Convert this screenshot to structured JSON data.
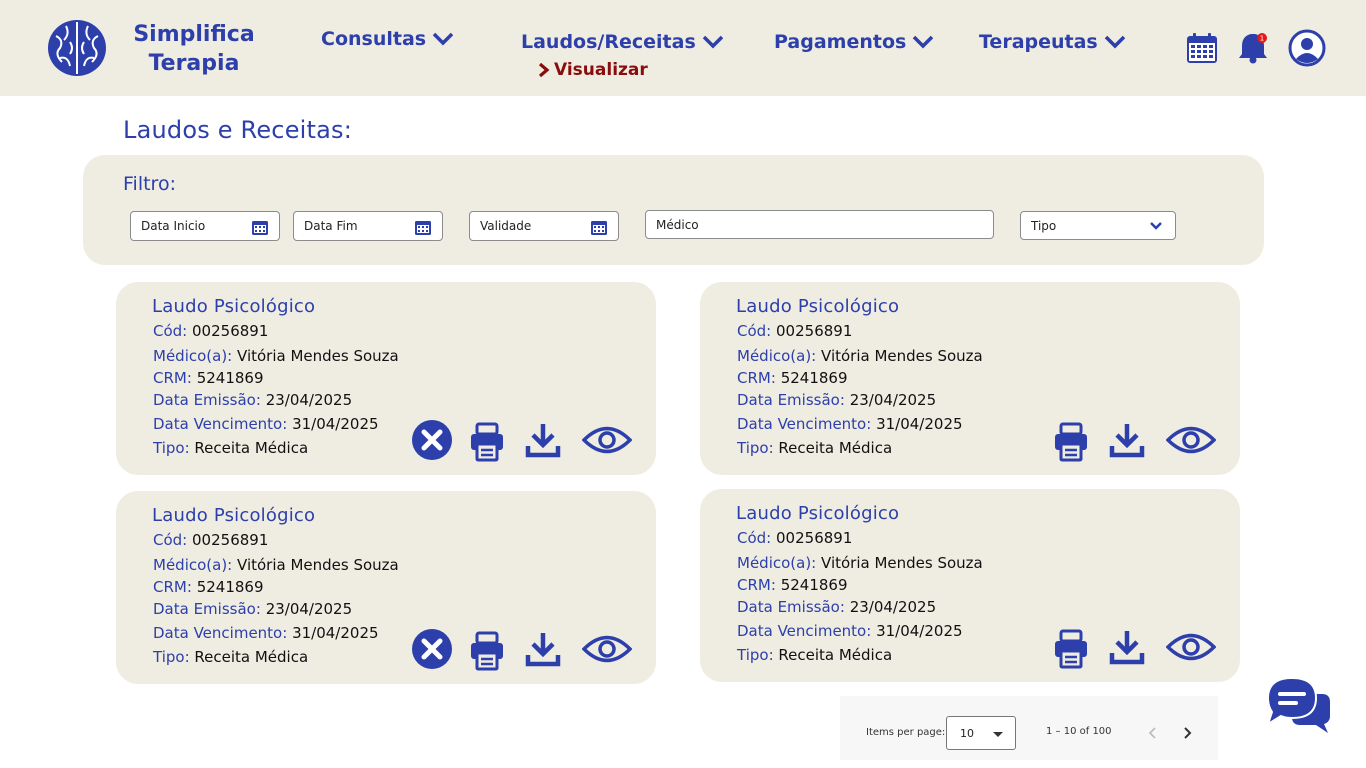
{
  "brand": {
    "line1": "Simplifica",
    "line2": "Terapia",
    "logo_icon": "brain-icon"
  },
  "nav": {
    "consultas": "Consultas",
    "laudos": "Laudos/Receitas",
    "laudos_sub": "Visualizar",
    "pagamentos": "Pagamentos",
    "terapeutas": "Terapeutas"
  },
  "header_icons": {
    "calendar": "calendar-icon",
    "bell": "bell-icon",
    "bell_badge": "1",
    "user": "user-icon"
  },
  "page": {
    "title": "Laudos e Receitas:"
  },
  "filter": {
    "label": "Filtro:",
    "data_inicio": "Data Inicio",
    "data_fim": "Data Fim",
    "validade": "Validade",
    "medico": "Médico",
    "tipo": "Tipo"
  },
  "labels": {
    "cod": "Cód:",
    "medico": "Médico(a):",
    "crm": "CRM:",
    "emissao": "Data Emissão:",
    "vencimento": "Data Vencimento:",
    "tipo": "Tipo:"
  },
  "cards": [
    {
      "title": "Laudo Psicológico",
      "cod": "00256891",
      "medico": "Vitória Mendes Souza",
      "crm": "5241869",
      "emissao": "23/04/2025",
      "vencimento": "31/04/2025",
      "tipo": "Receita Médica",
      "cancel": true
    },
    {
      "title": "Laudo Psicológico",
      "cod": "00256891",
      "medico": "Vitória Mendes Souza",
      "crm": "5241869",
      "emissao": "23/04/2025",
      "vencimento": "31/04/2025",
      "tipo": "Receita Médica",
      "cancel": false
    },
    {
      "title": "Laudo Psicológico",
      "cod": "00256891",
      "medico": "Vitória Mendes Souza",
      "crm": "5241869",
      "emissao": "23/04/2025",
      "vencimento": "31/04/2025",
      "tipo": "Receita Médica",
      "cancel": true
    },
    {
      "title": "Laudo Psicológico",
      "cod": "00256891",
      "medico": "Vitória Mendes Souza",
      "crm": "5241869",
      "emissao": "23/04/2025",
      "vencimento": "31/04/2025",
      "tipo": "Receita Médica",
      "cancel": false
    }
  ],
  "pagination": {
    "items_per_page_label": "Items per page:",
    "items_per_page": "10",
    "range": "1 – 10 of 100"
  },
  "colors": {
    "primary": "#2c3fab",
    "accent_red": "#8a0d0d",
    "panel": "#efece2"
  }
}
